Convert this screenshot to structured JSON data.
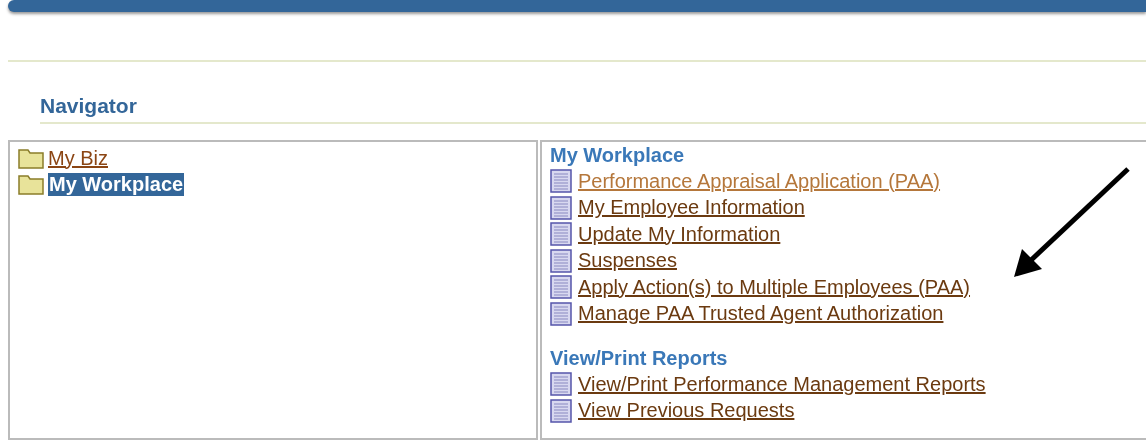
{
  "heading": "Navigator",
  "tree": [
    {
      "label": "My Biz",
      "selected": false
    },
    {
      "label": "My Workplace",
      "selected": true
    }
  ],
  "sections": [
    {
      "title": "My Workplace",
      "links": [
        {
          "label": "Performance Appraisal Application (PAA)",
          "visited": true
        },
        {
          "label": "My Employee Information",
          "visited": false
        },
        {
          "label": "Update My Information",
          "visited": false
        },
        {
          "label": "Suspenses",
          "visited": false
        },
        {
          "label": "Apply Action(s) to Multiple Employees (PAA)",
          "visited": false
        },
        {
          "label": "Manage PAA Trusted Agent Authorization",
          "visited": false
        }
      ]
    },
    {
      "title": "View/Print Reports",
      "links": [
        {
          "label": "View/Print Performance Management Reports",
          "visited": false
        },
        {
          "label": "View Previous Requests",
          "visited": false
        }
      ]
    }
  ]
}
